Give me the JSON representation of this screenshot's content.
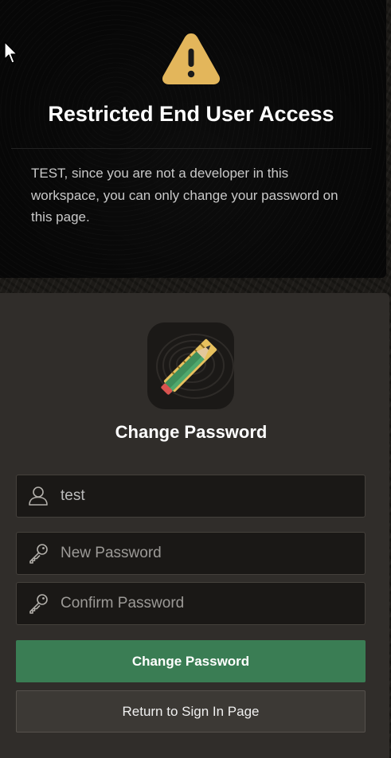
{
  "alert": {
    "icon": "warning-icon",
    "title": "Restricted End User Access",
    "message": "TEST, since you are not a developer in this workspace, you can only change your password on this page."
  },
  "form": {
    "logo": "pencil-ruler-icon",
    "title": "Change Password",
    "username": {
      "value": "test",
      "icon": "user-icon"
    },
    "new_password": {
      "placeholder": "New Password",
      "icon": "key-icon"
    },
    "confirm_password": {
      "placeholder": "Confirm Password",
      "icon": "key-icon"
    },
    "submit_label": "Change Password",
    "return_label": "Return to Sign In Page"
  },
  "colors": {
    "accent_green": "#3a7d54",
    "warning_yellow": "#e3b65b",
    "card_bg": "#302d2a"
  }
}
